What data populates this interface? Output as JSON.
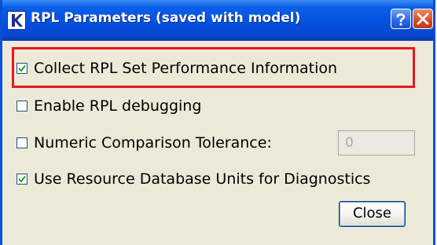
{
  "window": {
    "title": "RPL Parameters (saved with model)",
    "icons": {
      "app": "rpl-app-icon",
      "help": "help-icon",
      "close": "close-icon"
    }
  },
  "options": [
    {
      "label": "Collect RPL Set Performance Information",
      "checked": true,
      "highlighted": true
    },
    {
      "label": "Enable RPL debugging",
      "checked": false
    },
    {
      "label": "Numeric Comparison Tolerance:",
      "checked": false
    },
    {
      "label": "Use Resource Database Units for Diagnostics",
      "checked": true
    }
  ],
  "tolerance": {
    "value": "0",
    "enabled": false
  },
  "buttons": {
    "close_label": "Close"
  },
  "colors": {
    "titlebar": "#0450e0",
    "highlight_border": "#e8181b",
    "dialog_bg": "#ece9d8"
  }
}
